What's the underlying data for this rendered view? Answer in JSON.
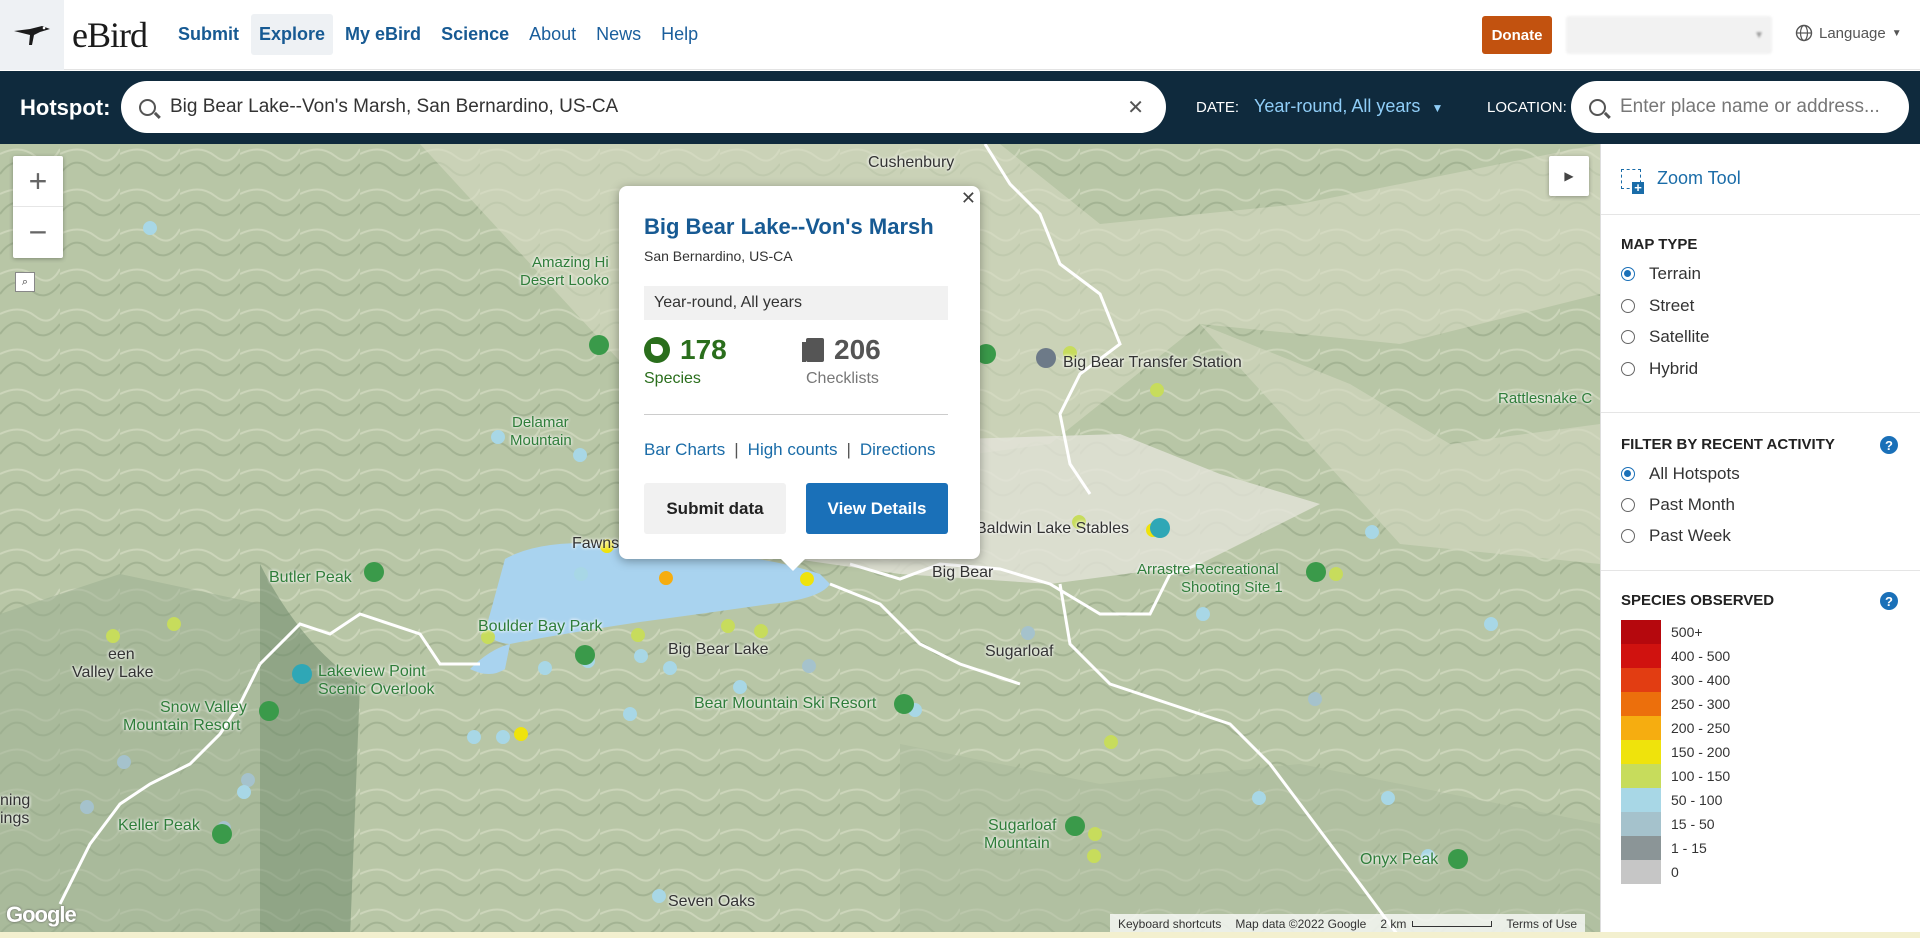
{
  "nav": {
    "brand": "eBird",
    "links": [
      {
        "label": "Submit",
        "bold": true,
        "active": false
      },
      {
        "label": "Explore",
        "bold": true,
        "active": true
      },
      {
        "label": "My eBird",
        "bold": true,
        "active": false
      },
      {
        "label": "Science",
        "bold": true,
        "active": false
      },
      {
        "label": "About",
        "bold": false,
        "active": false
      },
      {
        "label": "News",
        "bold": false,
        "active": false
      },
      {
        "label": "Help",
        "bold": false,
        "active": false
      }
    ],
    "donate": "Donate",
    "language": "Language"
  },
  "search": {
    "hotspot_label": "Hotspot:",
    "hotspot_value": "Big Bear Lake--Von's Marsh, San Bernardino, US-CA",
    "date_label": "DATE:",
    "date_value": "Year-round,  All years",
    "location_label": "LOCATION:",
    "location_placeholder": "Enter place name or address..."
  },
  "map": {
    "labels": [
      {
        "text": "Cushenbury",
        "green": false
      },
      {
        "text": "Amazing Hi",
        "green": true
      },
      {
        "text": "Desert Looko",
        "green": true
      },
      {
        "text": "Delamar",
        "green": true
      },
      {
        "text": "Mountain",
        "green": true
      },
      {
        "text": "Big Bear Transfer Station",
        "green": false
      },
      {
        "text": "Rattlesnake C",
        "green": true
      },
      {
        "text": "Baldwin Lake Stables",
        "green": false
      },
      {
        "text": "Fawns",
        "green": false
      },
      {
        "text": "Big Bear",
        "green": false
      },
      {
        "text": "Arrastre Recreational",
        "green": true
      },
      {
        "text": "Shooting Site 1",
        "green": true
      },
      {
        "text": "Butler Peak",
        "green": true
      },
      {
        "text": "Boulder Bay Park",
        "green": true
      },
      {
        "text": "Big Bear Lake",
        "green": false
      },
      {
        "text": "Sugarloaf",
        "green": false
      },
      {
        "text": "een",
        "green": false
      },
      {
        "text": "Valley Lake",
        "green": false
      },
      {
        "text": "Lakeview Point",
        "green": true
      },
      {
        "text": "Scenic Overlook",
        "green": true
      },
      {
        "text": "Snow Valley",
        "green": true
      },
      {
        "text": "Mountain Resort",
        "green": true
      },
      {
        "text": "Bear Mountain Ski Resort",
        "green": true
      },
      {
        "text": "ning",
        "green": false
      },
      {
        "text": "ings",
        "green": false
      },
      {
        "text": "Keller Peak",
        "green": true
      },
      {
        "text": "Sugarloaf",
        "green": true
      },
      {
        "text": "Mountain",
        "green": true
      },
      {
        "text": "Onyx Peak",
        "green": true
      },
      {
        "text": "Seven Oaks",
        "green": false
      }
    ],
    "attribution": [
      "Keyboard shortcuts",
      "Map data ©2022 Google",
      "2 km",
      "Terms of Use"
    ],
    "google": "Google"
  },
  "popup": {
    "title": "Big Bear Lake--Von's Marsh",
    "subtitle": "San Bernardino, US-CA",
    "period": "Year-round, All years",
    "species_count": "178",
    "species_label": "Species",
    "checklists_count": "206",
    "checklists_label": "Checklists",
    "links": [
      "Bar Charts",
      "High counts",
      "Directions"
    ],
    "submit_label": "Submit data",
    "view_label": "View Details"
  },
  "sidebar": {
    "zoom_tool": "Zoom Tool",
    "map_type_title": "MAP TYPE",
    "map_types": [
      {
        "label": "Terrain",
        "checked": true
      },
      {
        "label": "Street",
        "checked": false
      },
      {
        "label": "Satellite",
        "checked": false
      },
      {
        "label": "Hybrid",
        "checked": false
      }
    ],
    "filter_title": "FILTER BY RECENT ACTIVITY",
    "filters": [
      {
        "label": "All Hotspots",
        "checked": true
      },
      {
        "label": "Past Month",
        "checked": false
      },
      {
        "label": "Past Week",
        "checked": false
      }
    ],
    "species_title": "SPECIES OBSERVED",
    "legend": [
      {
        "label": "500+",
        "color": "#b5080d"
      },
      {
        "label": "400 - 500",
        "color": "#d0120f"
      },
      {
        "label": "300 - 400",
        "color": "#e23d12"
      },
      {
        "label": "250 - 300",
        "color": "#ec6f0c"
      },
      {
        "label": "200 - 250",
        "color": "#f6ad10"
      },
      {
        "label": "150 - 200",
        "color": "#efe30c"
      },
      {
        "label": "100 - 150",
        "color": "#c7dc5c"
      },
      {
        "label": "50 - 100",
        "color": "#a8d7e6"
      },
      {
        "label": "15 - 50",
        "color": "#a5c2cc"
      },
      {
        "label": "1 - 15",
        "color": "#8b9597"
      },
      {
        "label": "0",
        "color": "#c6c6c6"
      }
    ]
  },
  "colors": {
    "nav_dark": "#0f2a3d",
    "link_blue": "#1a6ca8",
    "donate": "#c2520f",
    "species_green": "#2a6e1c",
    "button_blue": "#1a70b8",
    "lake": "#a9d3ef"
  }
}
